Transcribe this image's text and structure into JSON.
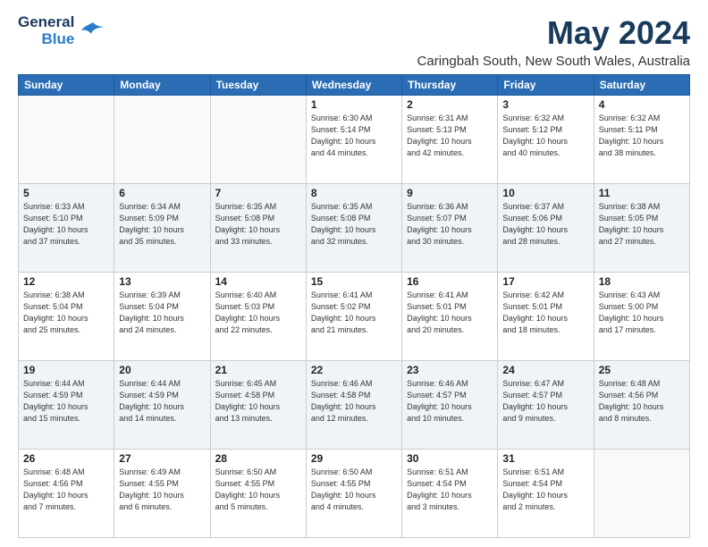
{
  "logo": {
    "line1": "General",
    "line2": "Blue",
    "bird": "▶"
  },
  "title": "May 2024",
  "subtitle": "Caringbah South, New South Wales, Australia",
  "days_of_week": [
    "Sunday",
    "Monday",
    "Tuesday",
    "Wednesday",
    "Thursday",
    "Friday",
    "Saturday"
  ],
  "weeks": [
    [
      {
        "day": "",
        "info": ""
      },
      {
        "day": "",
        "info": ""
      },
      {
        "day": "",
        "info": ""
      },
      {
        "day": "1",
        "info": "Sunrise: 6:30 AM\nSunset: 5:14 PM\nDaylight: 10 hours\nand 44 minutes."
      },
      {
        "day": "2",
        "info": "Sunrise: 6:31 AM\nSunset: 5:13 PM\nDaylight: 10 hours\nand 42 minutes."
      },
      {
        "day": "3",
        "info": "Sunrise: 6:32 AM\nSunset: 5:12 PM\nDaylight: 10 hours\nand 40 minutes."
      },
      {
        "day": "4",
        "info": "Sunrise: 6:32 AM\nSunset: 5:11 PM\nDaylight: 10 hours\nand 38 minutes."
      }
    ],
    [
      {
        "day": "5",
        "info": "Sunrise: 6:33 AM\nSunset: 5:10 PM\nDaylight: 10 hours\nand 37 minutes."
      },
      {
        "day": "6",
        "info": "Sunrise: 6:34 AM\nSunset: 5:09 PM\nDaylight: 10 hours\nand 35 minutes."
      },
      {
        "day": "7",
        "info": "Sunrise: 6:35 AM\nSunset: 5:08 PM\nDaylight: 10 hours\nand 33 minutes."
      },
      {
        "day": "8",
        "info": "Sunrise: 6:35 AM\nSunset: 5:08 PM\nDaylight: 10 hours\nand 32 minutes."
      },
      {
        "day": "9",
        "info": "Sunrise: 6:36 AM\nSunset: 5:07 PM\nDaylight: 10 hours\nand 30 minutes."
      },
      {
        "day": "10",
        "info": "Sunrise: 6:37 AM\nSunset: 5:06 PM\nDaylight: 10 hours\nand 28 minutes."
      },
      {
        "day": "11",
        "info": "Sunrise: 6:38 AM\nSunset: 5:05 PM\nDaylight: 10 hours\nand 27 minutes."
      }
    ],
    [
      {
        "day": "12",
        "info": "Sunrise: 6:38 AM\nSunset: 5:04 PM\nDaylight: 10 hours\nand 25 minutes."
      },
      {
        "day": "13",
        "info": "Sunrise: 6:39 AM\nSunset: 5:04 PM\nDaylight: 10 hours\nand 24 minutes."
      },
      {
        "day": "14",
        "info": "Sunrise: 6:40 AM\nSunset: 5:03 PM\nDaylight: 10 hours\nand 22 minutes."
      },
      {
        "day": "15",
        "info": "Sunrise: 6:41 AM\nSunset: 5:02 PM\nDaylight: 10 hours\nand 21 minutes."
      },
      {
        "day": "16",
        "info": "Sunrise: 6:41 AM\nSunset: 5:01 PM\nDaylight: 10 hours\nand 20 minutes."
      },
      {
        "day": "17",
        "info": "Sunrise: 6:42 AM\nSunset: 5:01 PM\nDaylight: 10 hours\nand 18 minutes."
      },
      {
        "day": "18",
        "info": "Sunrise: 6:43 AM\nSunset: 5:00 PM\nDaylight: 10 hours\nand 17 minutes."
      }
    ],
    [
      {
        "day": "19",
        "info": "Sunrise: 6:44 AM\nSunset: 4:59 PM\nDaylight: 10 hours\nand 15 minutes."
      },
      {
        "day": "20",
        "info": "Sunrise: 6:44 AM\nSunset: 4:59 PM\nDaylight: 10 hours\nand 14 minutes."
      },
      {
        "day": "21",
        "info": "Sunrise: 6:45 AM\nSunset: 4:58 PM\nDaylight: 10 hours\nand 13 minutes."
      },
      {
        "day": "22",
        "info": "Sunrise: 6:46 AM\nSunset: 4:58 PM\nDaylight: 10 hours\nand 12 minutes."
      },
      {
        "day": "23",
        "info": "Sunrise: 6:46 AM\nSunset: 4:57 PM\nDaylight: 10 hours\nand 10 minutes."
      },
      {
        "day": "24",
        "info": "Sunrise: 6:47 AM\nSunset: 4:57 PM\nDaylight: 10 hours\nand 9 minutes."
      },
      {
        "day": "25",
        "info": "Sunrise: 6:48 AM\nSunset: 4:56 PM\nDaylight: 10 hours\nand 8 minutes."
      }
    ],
    [
      {
        "day": "26",
        "info": "Sunrise: 6:48 AM\nSunset: 4:56 PM\nDaylight: 10 hours\nand 7 minutes."
      },
      {
        "day": "27",
        "info": "Sunrise: 6:49 AM\nSunset: 4:55 PM\nDaylight: 10 hours\nand 6 minutes."
      },
      {
        "day": "28",
        "info": "Sunrise: 6:50 AM\nSunset: 4:55 PM\nDaylight: 10 hours\nand 5 minutes."
      },
      {
        "day": "29",
        "info": "Sunrise: 6:50 AM\nSunset: 4:55 PM\nDaylight: 10 hours\nand 4 minutes."
      },
      {
        "day": "30",
        "info": "Sunrise: 6:51 AM\nSunset: 4:54 PM\nDaylight: 10 hours\nand 3 minutes."
      },
      {
        "day": "31",
        "info": "Sunrise: 6:51 AM\nSunset: 4:54 PM\nDaylight: 10 hours\nand 2 minutes."
      },
      {
        "day": "",
        "info": ""
      }
    ]
  ]
}
